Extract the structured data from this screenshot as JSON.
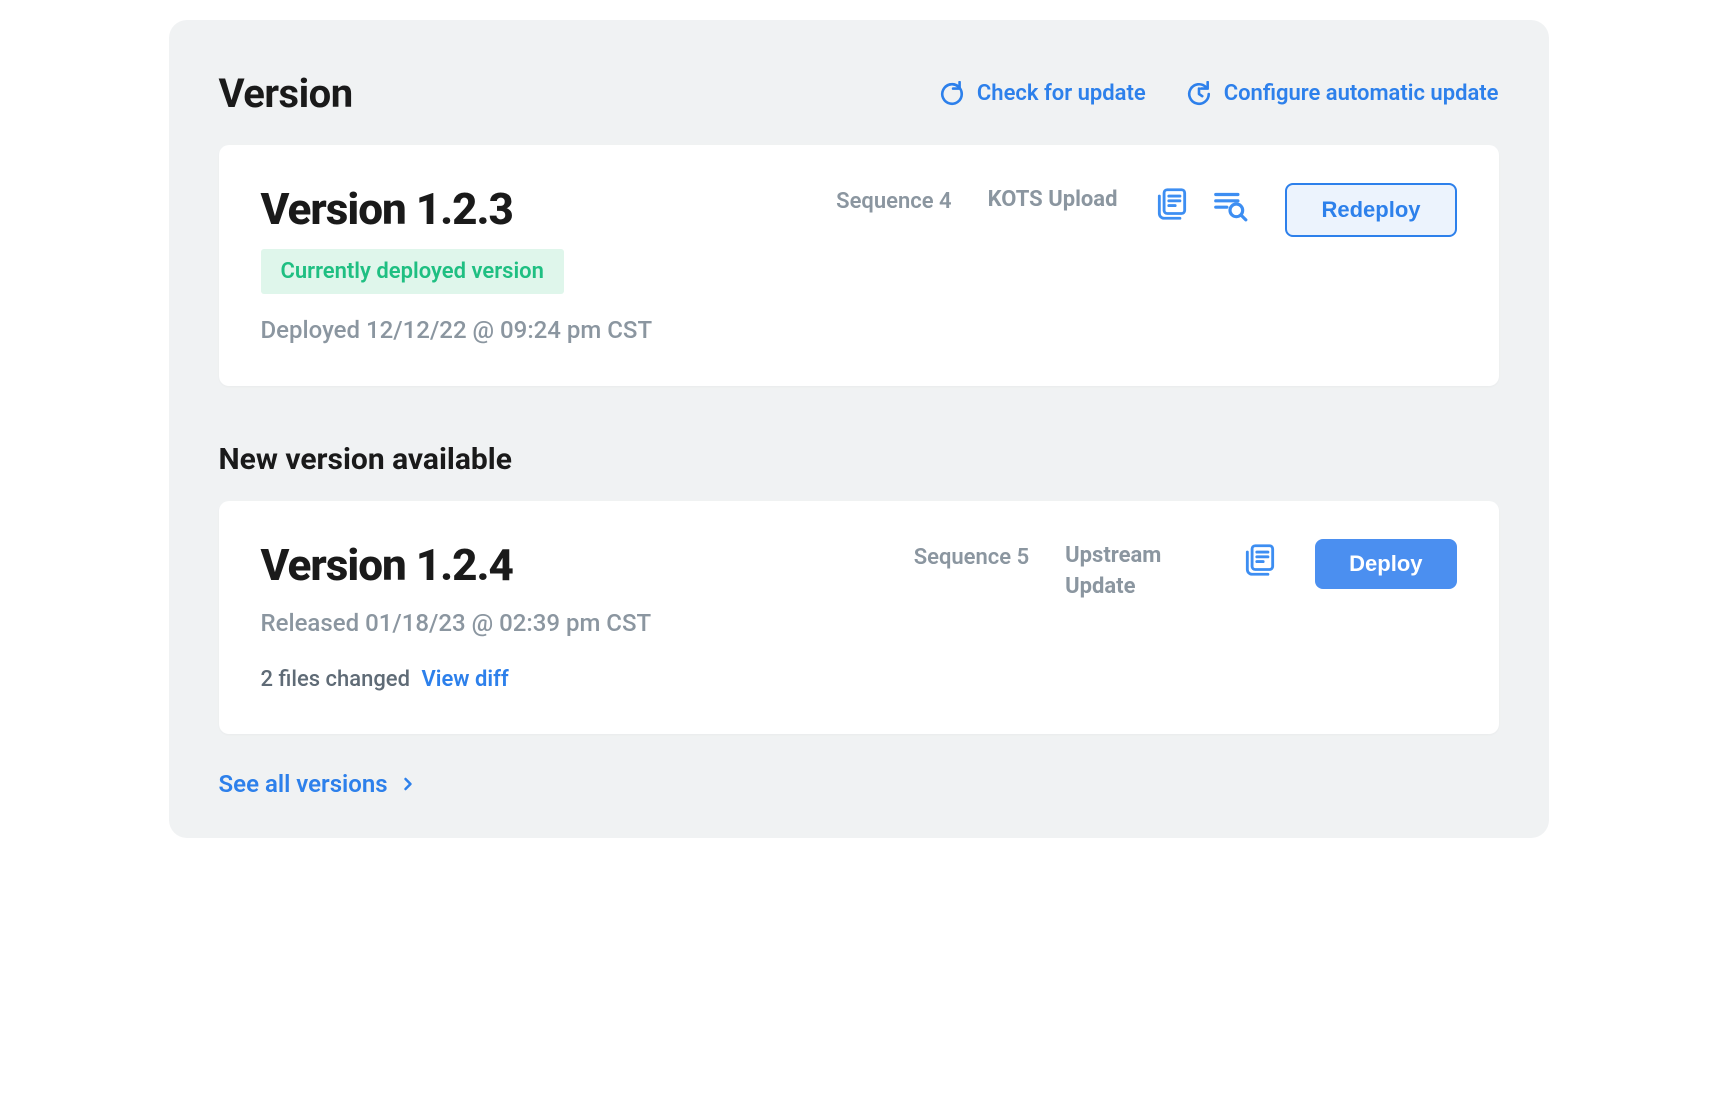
{
  "header": {
    "title": "Version",
    "check_update": "Check for update",
    "configure_auto": "Configure automatic update"
  },
  "current": {
    "title": "Version 1.2.3",
    "badge": "Currently deployed version",
    "deployed": "Deployed 12/12/22 @ 09:24 pm CST",
    "sequence": "Sequence 4",
    "source": "KOTS Upload",
    "action_label": "Redeploy"
  },
  "new_section_title": "New version available",
  "new": {
    "title": "Version 1.2.4",
    "released": "Released 01/18/23 @ 02:39 pm CST",
    "files_changed": "2 files changed",
    "view_diff": "View diff",
    "sequence": "Sequence 5",
    "source": "Upstream Update",
    "action_label": "Deploy"
  },
  "footer": {
    "see_all": "See all versions"
  },
  "colors": {
    "accent": "#2d80eb",
    "green": "#1fbf82"
  }
}
